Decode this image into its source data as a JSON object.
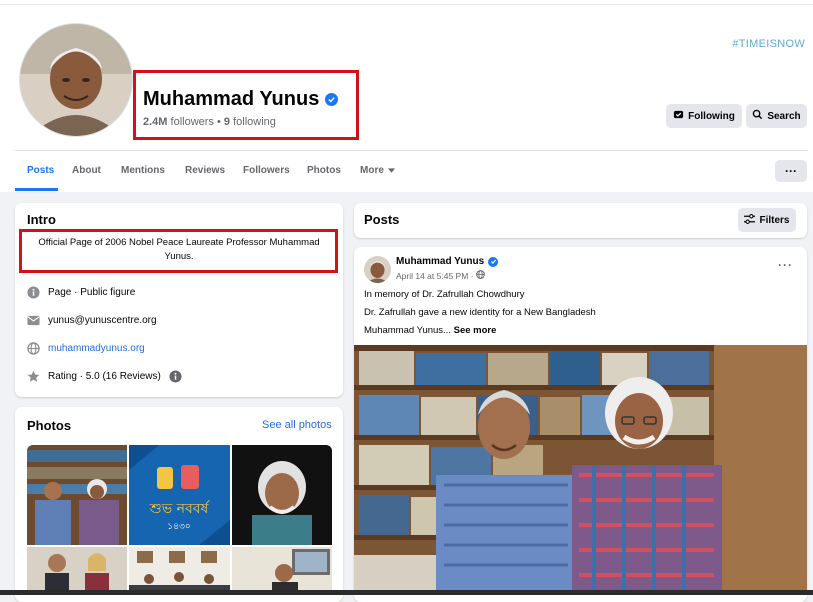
{
  "brand": {
    "accent": "#1877f2",
    "highlight_box": "#d0121b",
    "page_bg": "#f0f2f5"
  },
  "header": {
    "hashtag": "#TIMEISNOW",
    "name": "Muhammad Yunus",
    "followers": "2.4M",
    "followers_word": "followers",
    "separator": "•",
    "following_count": "9",
    "following_word": "following",
    "following_button": "Following",
    "search_button": "Search",
    "more_button": "···"
  },
  "tabs": [
    {
      "label": "Posts",
      "active": true
    },
    {
      "label": "About"
    },
    {
      "label": "Mentions"
    },
    {
      "label": "Reviews"
    },
    {
      "label": "Followers"
    },
    {
      "label": "Photos"
    },
    {
      "label": "More"
    }
  ],
  "intro": {
    "title": "Intro",
    "bio": "Official Page of 2006 Nobel Peace Laureate Professor Muhammad Yunus.",
    "rows": [
      {
        "icon": "info-icon",
        "text": "Page · Public figure"
      },
      {
        "icon": "email-icon",
        "text": "yunus@yunuscentre.org"
      },
      {
        "icon": "globe-icon",
        "text": "muhammadyunus.org"
      },
      {
        "icon": "star-icon",
        "text": "Rating · 5.0 (16 Reviews)"
      }
    ]
  },
  "photos": {
    "title": "Photos",
    "see_all": "See all photos"
  },
  "posts": {
    "title": "Posts",
    "filters_button": "Filters",
    "post": {
      "author": "Muhammad Yunus",
      "date": "April 14 at 5:45 PM ·",
      "line1": "In memory of Dr. Zafrullah Chowdhury",
      "line2": "Dr. Zafrullah gave a new identity for a New Bangladesh",
      "line3": "Muhammad Yunus...",
      "see_more": "See more",
      "menu": "···"
    }
  }
}
